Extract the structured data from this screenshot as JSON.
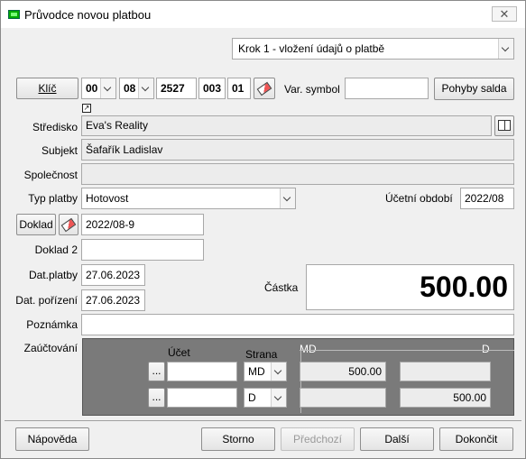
{
  "window": {
    "title": "Průvodce novou platbou",
    "close": "✕"
  },
  "step": {
    "value": "Krok 1 - vložení údajů o platbě"
  },
  "key": {
    "label": "Klíč",
    "seg1": "00",
    "seg2": "08",
    "seg3": "2527",
    "seg4": "003",
    "seg5": "01"
  },
  "var_symbol": {
    "label": "Var. symbol",
    "value": ""
  },
  "saldo_button": "Pohyby salda",
  "fields": {
    "stredisko": {
      "label": "Středisko",
      "value": "Eva's Reality"
    },
    "subjekt": {
      "label": "Subjekt",
      "value": "Šafařík Ladislav"
    },
    "spolecnost": {
      "label": "Společnost",
      "value": ""
    },
    "typ_platby": {
      "label": "Typ platby",
      "value": "Hotovost"
    },
    "ucetni_obdobi": {
      "label": "Účetní období",
      "value": "2022/08"
    },
    "doklad": {
      "label": "Doklad",
      "value": "2022/08-9"
    },
    "doklad2": {
      "label": "Doklad 2",
      "value": ""
    },
    "dat_platby": {
      "label": "Dat.platby",
      "value": "27.06.2023"
    },
    "dat_porizeni": {
      "label": "Dat. pořízení",
      "value": "27.06.2023"
    },
    "castka": {
      "label": "Částka",
      "value": "500.00"
    },
    "poznamka": {
      "label": "Poznámka",
      "value": ""
    }
  },
  "zauctovani": {
    "label": "Zaúčtování",
    "col_ucet": "Účet",
    "col_strana": "Strana",
    "col_md": "MD",
    "col_d": "D",
    "rows": [
      {
        "ellipsis": "...",
        "ucet": "",
        "strana": "MD",
        "md": "500.00",
        "d": ""
      },
      {
        "ellipsis": "...",
        "ucet": "",
        "strana": "D",
        "md": "",
        "d": "500.00"
      }
    ]
  },
  "buttons": {
    "help": "Nápověda",
    "cancel": "Storno",
    "prev": "Předchozí",
    "next": "Další",
    "finish": "Dokončit"
  },
  "icons": {
    "app": "app-icon",
    "eraser": "eraser-icon",
    "book": "book-icon",
    "shortcut": "shortcut-arrow-icon"
  }
}
